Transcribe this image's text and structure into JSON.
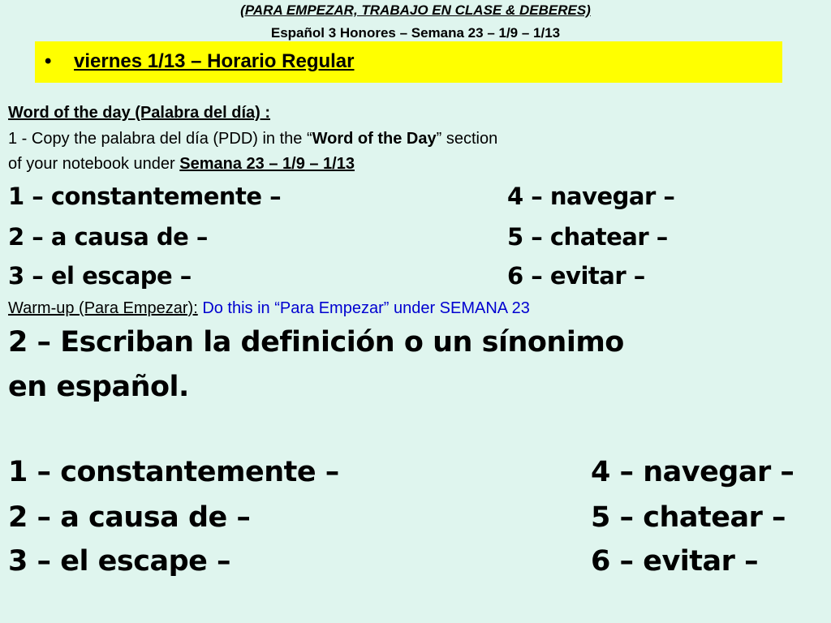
{
  "header": {
    "line1": "(PARA EMPEZAR, TRABAJO EN CLASE & DEBERES)",
    "line2": "Español 3 Honores – Semana 23 – 1/9 – 1/13"
  },
  "agenda": {
    "bullet": "•",
    "item": "viernes 1/13 – Horario Regular"
  },
  "word_of_day": {
    "title": "Word of the day (Palabra del día) :",
    "step1_prefix": "1 - Copy the palabra del día (PDD) in the “",
    "step1_bold": "Word of the Day",
    "step1_suffix": "” section",
    "step2_prefix": "of your notebook under ",
    "step2_link": "Semana 23 – 1/9 – 1/13"
  },
  "vocab": [
    "1 – constantemente –",
    "2 – a causa de –",
    "3 – el escape –",
    "4 – navegar –",
    "5 – chatear –",
    "6 – evitar –"
  ],
  "warmup": {
    "label": "Warm-up (Para Empezar):",
    "instruction": "Do this in “Para Empezar” under SEMANA 23"
  },
  "prompt": {
    "line1": "2 –  Escriban la definición o un sínonimo",
    "line2": "en español."
  }
}
